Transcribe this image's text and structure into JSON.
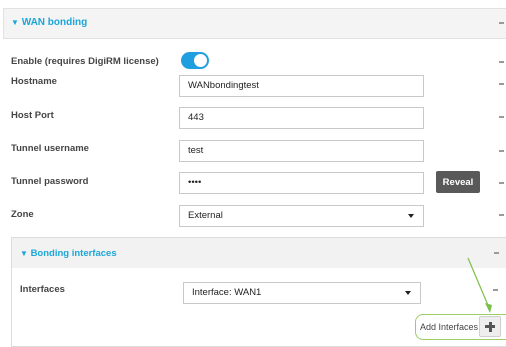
{
  "section": {
    "caret": "▼",
    "title": "WAN bonding"
  },
  "fields": {
    "enable": {
      "label": "Enable (requires DigiRM license)",
      "value": "on"
    },
    "hostname": {
      "label": "Hostname",
      "value": "WANbondingtest"
    },
    "host_port": {
      "label": "Host Port",
      "value": "443"
    },
    "tunnel_username": {
      "label": "Tunnel username",
      "value": "test"
    },
    "tunnel_password": {
      "label": "Tunnel password",
      "value": "••••"
    },
    "zone": {
      "label": "Zone",
      "value": "External"
    }
  },
  "reveal_button": "Reveal",
  "bonding": {
    "caret": "▼",
    "title": "Bonding interfaces",
    "interfaces_label": "Interfaces",
    "interface_value": "Interface: WAN1",
    "add_label": "Add Interfaces"
  },
  "colors": {
    "accent": "#1aa6d8",
    "toggle": "#1f9fe0",
    "callout": "#7cc04a",
    "reveal_bg": "#595959"
  }
}
